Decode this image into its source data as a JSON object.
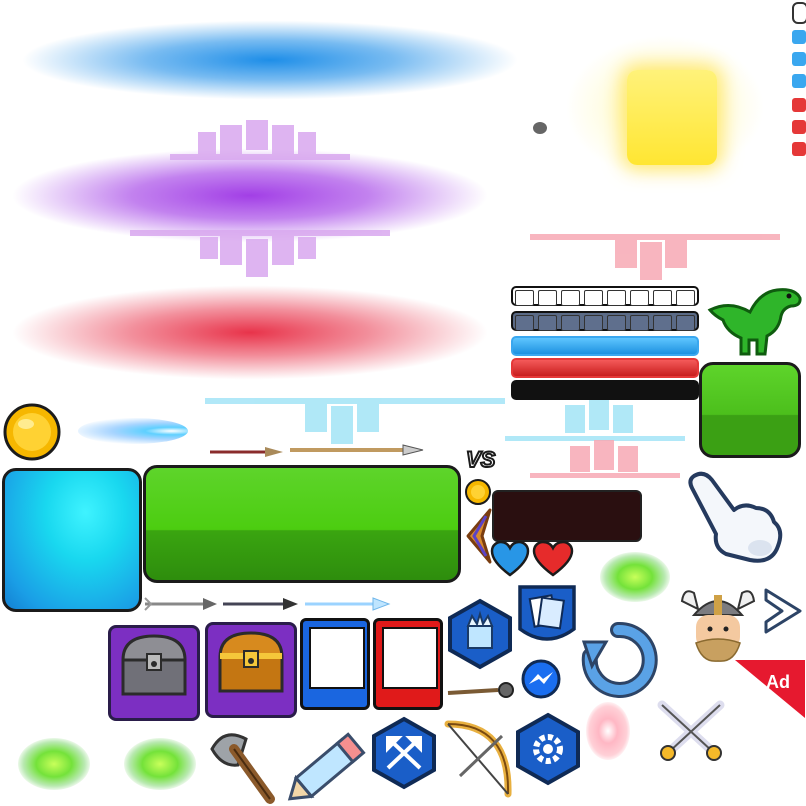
{
  "labels": {
    "vs": "VS",
    "ad": "Ad"
  },
  "colors": {
    "blue_glow": "#1e8ee8",
    "purple_glow": "#a23fe6",
    "red_glow": "#e8334a",
    "yellow_glow": "#fff25a",
    "green_button": "#4ccd10",
    "cyan_button": "#19d8ef",
    "blue_card": "#1a66e0",
    "red_card": "#e01a1a",
    "hex_blue": "#1a5ec8",
    "purple_chest_bg": "#7c2fc2"
  },
  "bars": [
    {
      "name": "white-bar",
      "color": "#ffffff",
      "segmented": true
    },
    {
      "name": "gray-bar",
      "color": "#5a6a86",
      "segmented": true
    },
    {
      "name": "blue-bar",
      "color": "#35a9ef",
      "segmented": false
    },
    {
      "name": "red-bar",
      "color": "#e53838",
      "segmented": false
    },
    {
      "name": "black-bar",
      "color": "#111111",
      "segmented": false
    }
  ],
  "icons": [
    "gold-coin-icon",
    "fireball-icon",
    "arrow-icon",
    "spear-icon",
    "boomerang-icon",
    "heart-icon",
    "pointing-hand-icon",
    "dinosaur-icon",
    "chest-icon",
    "card-icon",
    "crown-icon",
    "cards-icon",
    "messenger-icon",
    "refresh-icon",
    "viking-icon",
    "next-arrow-icon",
    "axe-icon",
    "pencil-icon",
    "crossed-arrows-icon",
    "bow-icon",
    "gear-icon",
    "crossed-swords-icon",
    "green-splash-icon",
    "portal-icon",
    "sun-glow-icon"
  ]
}
